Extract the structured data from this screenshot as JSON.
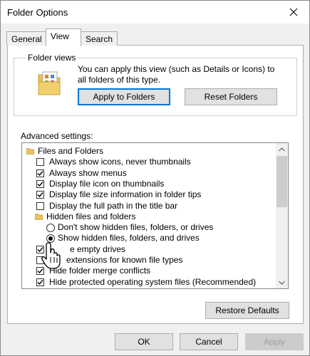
{
  "window": {
    "title": "Folder Options"
  },
  "tabs": [
    {
      "label": "General",
      "active": false
    },
    {
      "label": "View",
      "active": true
    },
    {
      "label": "Search",
      "active": false
    }
  ],
  "folder_views": {
    "label": "Folder views",
    "description": "You can apply this view (such as Details or Icons) to all folders of this type.",
    "apply_button": "Apply to Folders",
    "reset_button": "Reset Folders"
  },
  "advanced": {
    "label": "Advanced settings:",
    "items": [
      {
        "type": "folder",
        "label": "Files and Folders"
      },
      {
        "type": "checkbox",
        "checked": false,
        "label": "Always show icons, never thumbnails"
      },
      {
        "type": "checkbox",
        "checked": true,
        "label": "Always show menus"
      },
      {
        "type": "checkbox",
        "checked": true,
        "label": "Display file icon on thumbnails"
      },
      {
        "type": "checkbox",
        "checked": true,
        "label": "Display file size information in folder tips"
      },
      {
        "type": "checkbox",
        "checked": false,
        "label": "Display the full path in the title bar"
      },
      {
        "type": "folder",
        "label": "Hidden files and folders"
      },
      {
        "type": "radio",
        "checked": false,
        "label": "Don't show hidden files, folders, or drives"
      },
      {
        "type": "radio",
        "checked": true,
        "label": "Show hidden files, folders, and drives"
      },
      {
        "type": "checkbox",
        "checked": true,
        "label": "e empty drives"
      },
      {
        "type": "checkbox",
        "checked": false,
        "label": "extensions for known file types"
      },
      {
        "type": "checkbox",
        "checked": true,
        "label": "Hide folder merge conflicts"
      },
      {
        "type": "checkbox",
        "checked": true,
        "label": "Hide protected operating system files (Recommended)"
      }
    ]
  },
  "restore_button": "Restore Defaults",
  "footer": {
    "ok": "OK",
    "cancel": "Cancel",
    "apply": "Apply"
  },
  "colors": {
    "accent": "#0078d7",
    "folder": "#e8c25a"
  }
}
